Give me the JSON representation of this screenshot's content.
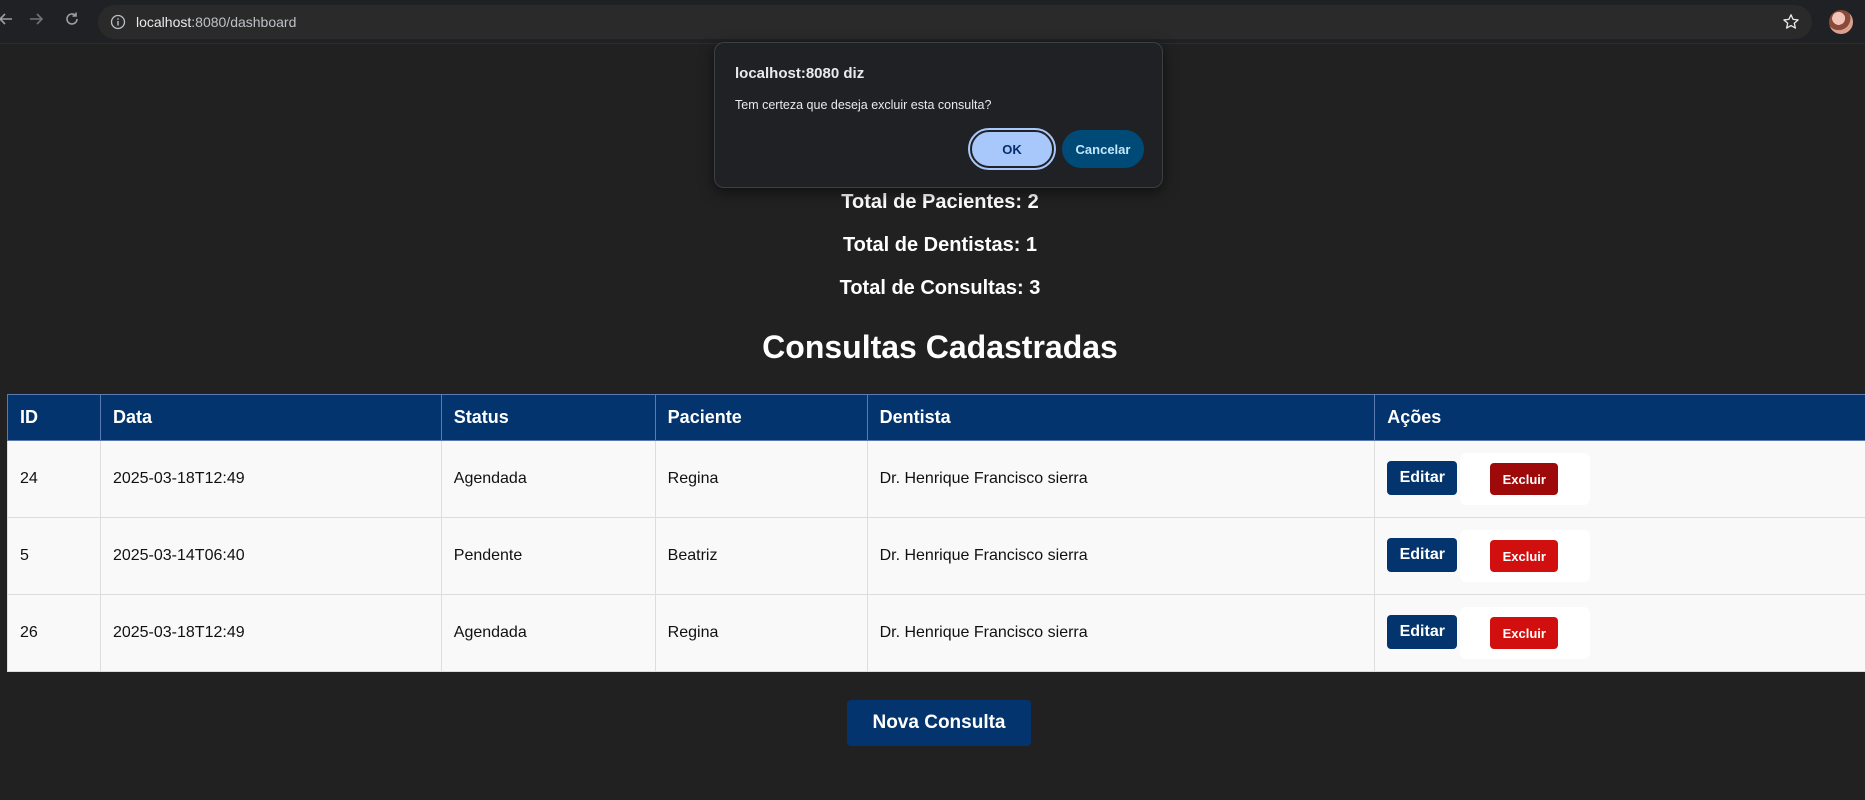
{
  "browser": {
    "url_host": "localhost",
    "url_rest": ":8080/dashboard"
  },
  "stats": {
    "pacientes": "Total de Pacientes: 2",
    "dentistas": "Total de Dentistas: 1",
    "consultas": "Total de Consultas: 3"
  },
  "section_title": "Consultas Cadastradas",
  "table": {
    "headers": [
      "ID",
      "Data",
      "Status",
      "Paciente",
      "Dentista",
      "Ações"
    ],
    "rows": [
      {
        "id": "24",
        "data": "2025-03-18T12:49",
        "status": "Agendada",
        "paciente": "Regina",
        "dentista": "Dr. Henrique Francisco sierra"
      },
      {
        "id": "5",
        "data": "2025-03-14T06:40",
        "status": "Pendente",
        "paciente": "Beatriz",
        "dentista": "Dr. Henrique Francisco sierra"
      },
      {
        "id": "26",
        "data": "2025-03-18T12:49",
        "status": "Agendada",
        "paciente": "Regina",
        "dentista": "Dr. Henrique Francisco sierra"
      }
    ],
    "edit_label": "Editar",
    "delete_label": "Excluir"
  },
  "new_button": "Nova Consulta",
  "dialog": {
    "title": "localhost:8080 diz",
    "message": "Tem certeza que deseja excluir esta consulta?",
    "ok_label": "OK",
    "cancel_label": "Cancelar"
  },
  "colors": {
    "primary": "#03346e",
    "danger": "#d10f0f",
    "background": "#212121"
  },
  "icons": [
    "back-arrow-icon",
    "forward-arrow-icon",
    "reload-icon",
    "info-icon",
    "star-icon"
  ]
}
